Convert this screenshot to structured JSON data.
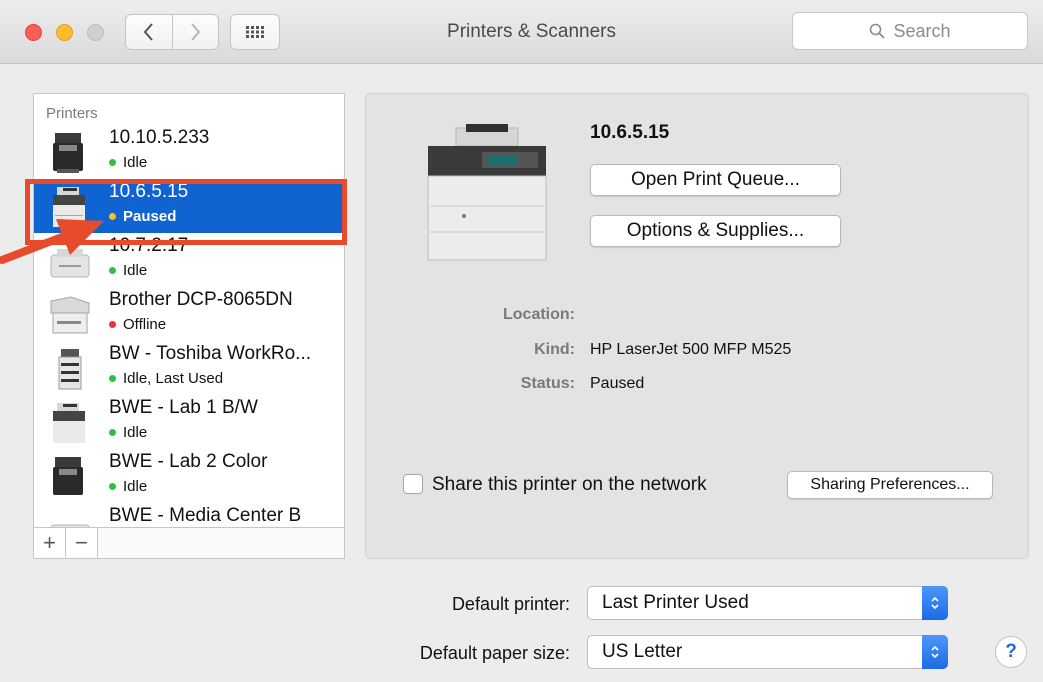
{
  "window": {
    "title": "Printers & Scanners",
    "search_placeholder": "Search"
  },
  "printer_list": {
    "header": "Printers",
    "items": [
      {
        "name": "10.10.5.233",
        "status": "Idle",
        "status_color": "#2fbf45"
      },
      {
        "name": "10.6.5.15",
        "status": "Paused",
        "status_color": "#f5c121"
      },
      {
        "name": "10.7.2.17",
        "status": "Idle",
        "status_color": "#2fbf45"
      },
      {
        "name": "Brother DCP-8065DN",
        "status": "Offline",
        "status_color": "#e8333a"
      },
      {
        "name": "BW - Toshiba WorkRo...",
        "status": "Idle, Last Used",
        "status_color": "#2fbf45"
      },
      {
        "name": "BWE - Lab 1 B/W",
        "status": "Idle",
        "status_color": "#2fbf45"
      },
      {
        "name": "BWE - Lab 2 Color",
        "status": "Idle",
        "status_color": "#2fbf45"
      },
      {
        "name": "BWE - Media Center B",
        "status": "",
        "status_color": "#2fbf45"
      }
    ],
    "add_label": "+",
    "remove_label": "−"
  },
  "detail": {
    "printer_name": "10.6.5.15",
    "open_queue_label": "Open Print Queue...",
    "options_label": "Options & Supplies...",
    "location_label": "Location:",
    "location_value": "",
    "kind_label": "Kind:",
    "kind_value": "HP LaserJet 500 MFP M525",
    "status_label": "Status:",
    "status_value": "Paused",
    "share_label": "Share this printer on the network",
    "share_checked": false,
    "sharing_prefs_label": "Sharing Preferences..."
  },
  "footer": {
    "default_printer_label": "Default printer:",
    "default_printer_value": "Last Printer Used",
    "paper_size_label": "Default paper size:",
    "paper_size_value": "US Letter",
    "help_label": "?"
  },
  "colors": {
    "selection": "#0f64d2",
    "highlight_annotation": "#e84b2c"
  }
}
